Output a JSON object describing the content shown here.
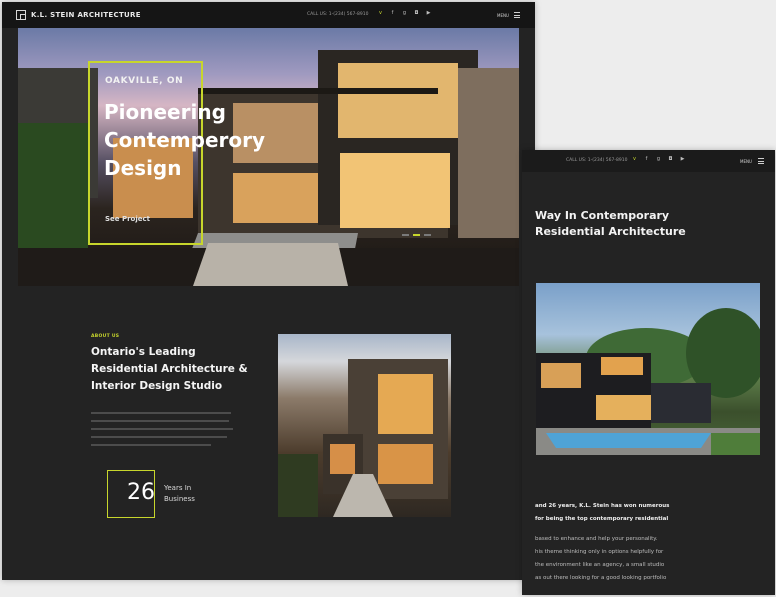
{
  "main": {
    "brand": "K.L. STEIN ARCHITECTURE",
    "phone": "CALL US: 1-(234) 567-8910",
    "social_icons": [
      "vimeo-icon",
      "facebook-icon",
      "google-plus-icon",
      "instagram-icon",
      "youtube-icon"
    ],
    "menu_label": "MENU",
    "hero": {
      "eyebrow": "OAKVILLE, ON",
      "title_lines": [
        "Pioneering",
        "Contemperory",
        "Design"
      ],
      "cta": "See Project"
    },
    "about": {
      "eyebrow": "ABOUT US",
      "title_lines": [
        "Ontario's Leading",
        "Residential Architecture &",
        "Interior Design Studio"
      ],
      "years_number": "26",
      "years_lines": [
        "Years In",
        "Business"
      ]
    }
  },
  "second": {
    "phone": "CALL US: 1-(234) 567-8910",
    "menu_label": "MENU",
    "title_lines": [
      "Way In Contemporary",
      "Residential Architecture"
    ],
    "body_bold_lines": [
      "and 26 years, K.L. Stein has won numerous",
      "for being the top contemporary residential"
    ],
    "body_lines": [
      "based to enhance and help your personality.",
      "his theme thinking only in options helpfully for",
      "the environment like an agency, a small studio",
      "as out there looking for a good looking portfolio"
    ]
  },
  "colors": {
    "accent": "#c7d62c",
    "background": "#232323",
    "topbar": "#151515"
  }
}
